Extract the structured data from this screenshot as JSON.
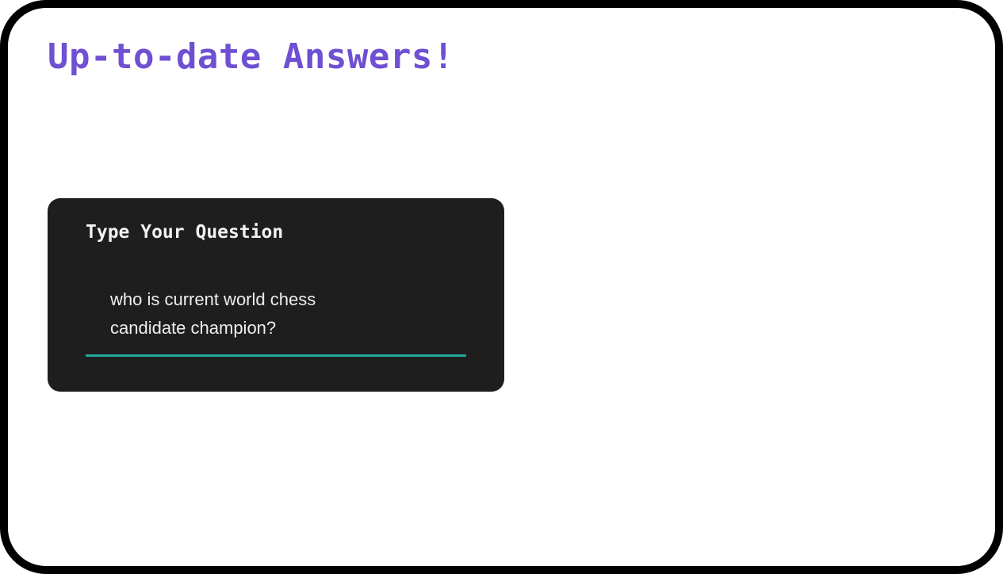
{
  "page": {
    "title": "Up-to-date Answers!"
  },
  "question_card": {
    "label": "Type Your Question",
    "input_value": "who is current world chess candidate champion?"
  },
  "colors": {
    "title": "#6f4fd2",
    "card_background": "#1e1e1e",
    "input_underline": "#22a79d",
    "frame_border": "#000000"
  }
}
